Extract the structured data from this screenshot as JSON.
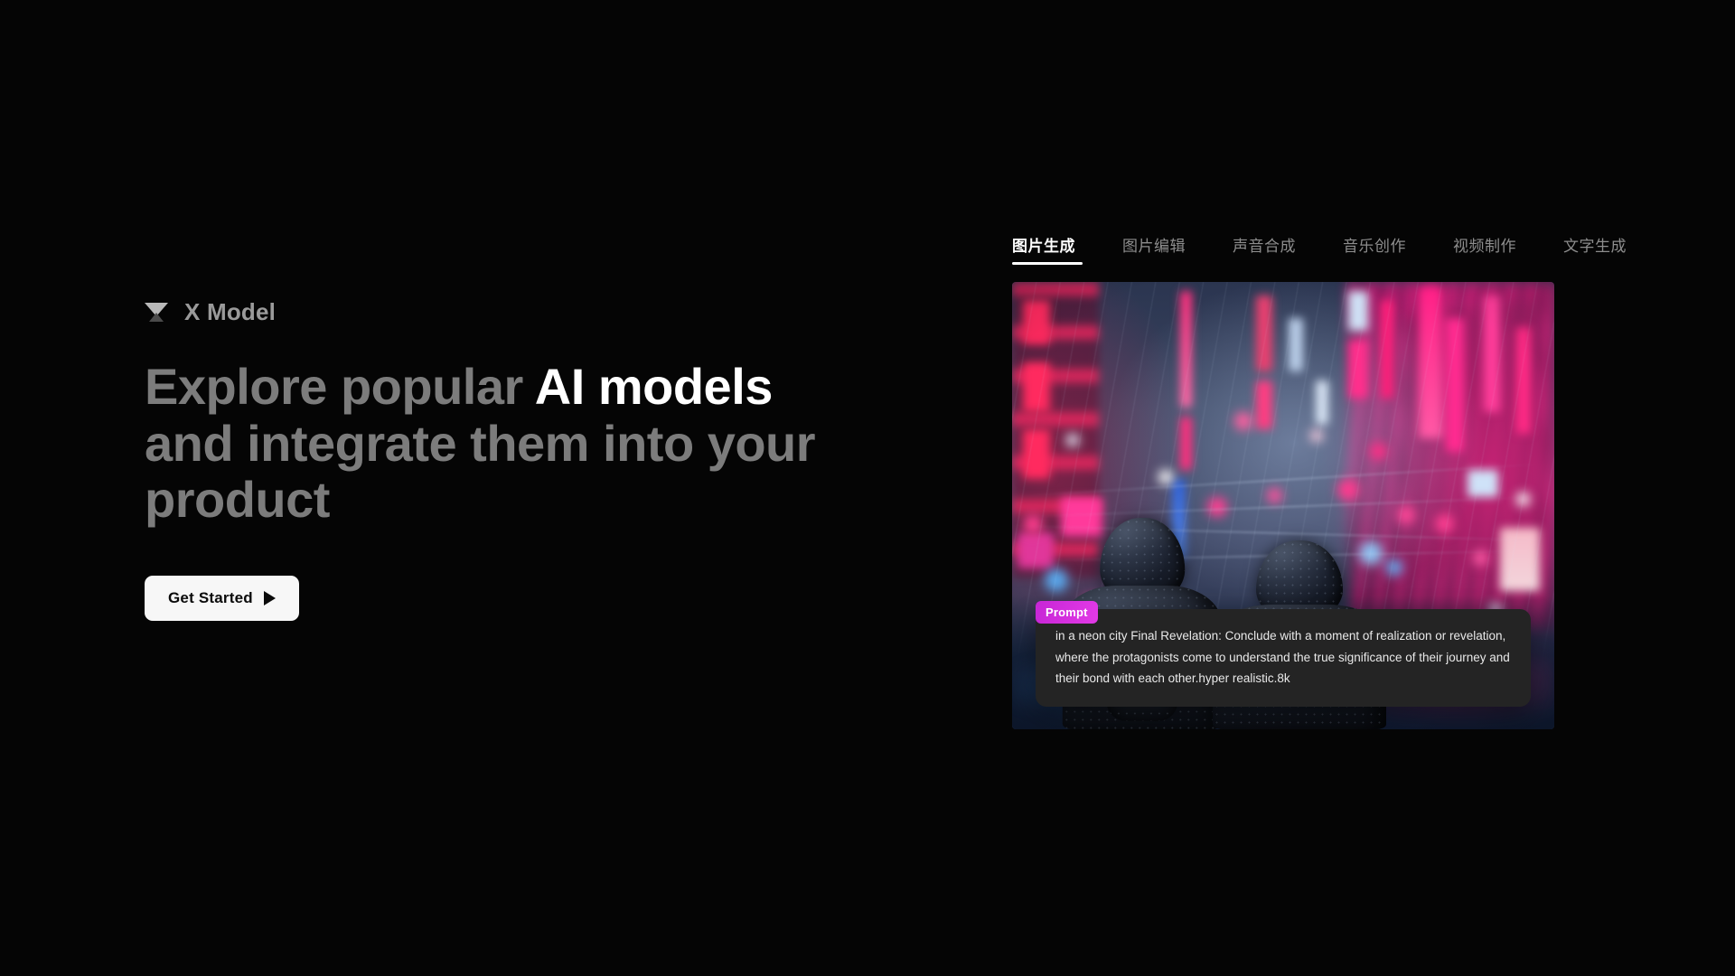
{
  "brand": {
    "logo_icon": "triangle-down-logo-icon",
    "name": "X Model"
  },
  "hero": {
    "headline_part1": "Explore popular ",
    "headline_highlight": "AI models",
    "headline_part2": " and integrate them into your product",
    "cta_label": "Get Started",
    "cta_icon": "play-triangle-icon"
  },
  "preview": {
    "tabs": [
      {
        "label": "图片生成",
        "active": true
      },
      {
        "label": "图片编辑",
        "active": false
      },
      {
        "label": "声音合成",
        "active": false
      },
      {
        "label": "音乐创作",
        "active": false
      },
      {
        "label": "视频制作",
        "active": false
      },
      {
        "label": "文字生成",
        "active": false
      }
    ],
    "artwork_alt": "Two hooded figures seen from behind standing in a rainy neon-lit cyberpunk city street",
    "prompt_badge": "Prompt",
    "prompt_text": "in a neon city Final Revelation: Conclude with a moment of realization or revelation, where the protagonists come to understand the true significance of their journey and their bond with each other.hyper realistic.8k"
  },
  "colors": {
    "page_background": "#050505",
    "headline_muted": "#7c7c7c",
    "headline_highlight": "#ffffff",
    "cta_background": "#f7f7f7",
    "cta_text": "#0b0b0b",
    "tab_active": "#ffffff",
    "tab_inactive": "#8d8d8d",
    "prompt_badge": "#d633e0",
    "prompt_panel": "#242424",
    "neon_pink": "#ff2a8f",
    "neon_blue": "#3a7fe0"
  }
}
